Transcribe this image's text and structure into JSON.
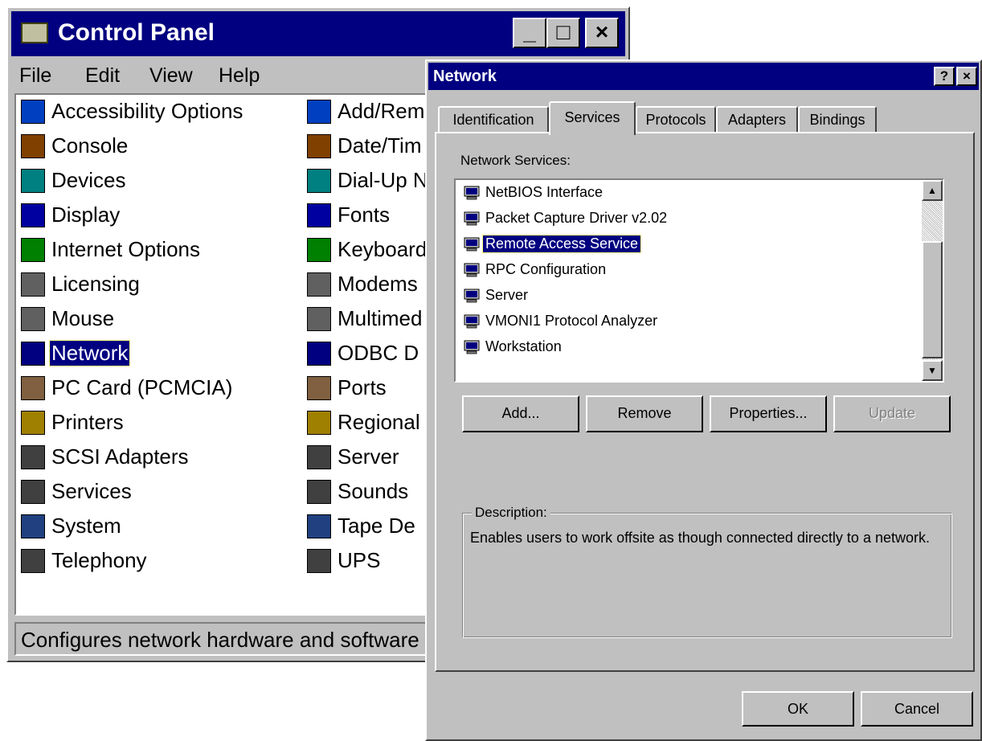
{
  "control_panel": {
    "title": "Control Panel",
    "window_buttons": {
      "minimize": "_",
      "maximize": "□",
      "close": "×"
    },
    "menu": [
      {
        "label": "File"
      },
      {
        "label": "Edit"
      },
      {
        "label": "View"
      },
      {
        "label": "Help"
      }
    ],
    "items_col1": [
      {
        "label": "Accessibility Options",
        "icon": "accessibility-icon"
      },
      {
        "label": "Console",
        "icon": "console-icon"
      },
      {
        "label": "Devices",
        "icon": "devices-icon"
      },
      {
        "label": "Display",
        "icon": "display-icon"
      },
      {
        "label": "Internet Options",
        "icon": "internet-options-icon"
      },
      {
        "label": "Licensing",
        "icon": "licensing-icon"
      },
      {
        "label": "Mouse",
        "icon": "mouse-icon"
      },
      {
        "label": "Network",
        "icon": "network-icon",
        "selected": true
      },
      {
        "label": "PC Card (PCMCIA)",
        "icon": "pc-card-icon"
      },
      {
        "label": "Printers",
        "icon": "printers-icon"
      },
      {
        "label": "SCSI Adapters",
        "icon": "scsi-icon"
      },
      {
        "label": "Services",
        "icon": "services-icon"
      },
      {
        "label": "System",
        "icon": "system-icon"
      },
      {
        "label": "Telephony",
        "icon": "telephony-icon"
      }
    ],
    "items_col2": [
      {
        "label": "Add/Rem",
        "icon": "add-remove-icon"
      },
      {
        "label": "Date/Tim",
        "icon": "date-time-icon"
      },
      {
        "label": "Dial-Up N",
        "icon": "dial-up-icon"
      },
      {
        "label": "Fonts",
        "icon": "fonts-icon"
      },
      {
        "label": "Keyboard",
        "icon": "keyboard-icon"
      },
      {
        "label": "Modems",
        "icon": "modems-icon"
      },
      {
        "label": "Multimed",
        "icon": "multimedia-icon"
      },
      {
        "label": "ODBC D",
        "icon": "odbc-icon"
      },
      {
        "label": "Ports",
        "icon": "ports-icon"
      },
      {
        "label": "Regional",
        "icon": "regional-icon"
      },
      {
        "label": "Server",
        "icon": "server-icon"
      },
      {
        "label": "Sounds",
        "icon": "sounds-icon"
      },
      {
        "label": "Tape De",
        "icon": "tape-devices-icon"
      },
      {
        "label": "UPS",
        "icon": "ups-icon"
      }
    ],
    "status": "Configures network hardware and software"
  },
  "network": {
    "title": "Network",
    "help_button": "?",
    "close_button": "×",
    "tabs": [
      {
        "label": "Identification"
      },
      {
        "label": "Services",
        "active": true
      },
      {
        "label": "Protocols"
      },
      {
        "label": "Adapters"
      },
      {
        "label": "Bindings"
      }
    ],
    "services_label": "Network Services:",
    "services": [
      {
        "label": "NetBIOS Interface"
      },
      {
        "label": "Packet Capture Driver v2.02"
      },
      {
        "label": "Remote Access Service",
        "selected": true
      },
      {
        "label": "RPC Configuration"
      },
      {
        "label": "Server"
      },
      {
        "label": "VMONI1 Protocol Analyzer"
      },
      {
        "label": "Workstation"
      }
    ],
    "buttons": {
      "add": "Add...",
      "remove": "Remove",
      "properties": "Properties...",
      "update": "Update"
    },
    "description_label": "Description:",
    "description": "Enables users to work offsite as though connected directly to a network.",
    "ok": "OK",
    "cancel": "Cancel",
    "colors": {
      "titlebar": "#000080",
      "face": "#c0c0c0",
      "selection": "#000080"
    }
  }
}
